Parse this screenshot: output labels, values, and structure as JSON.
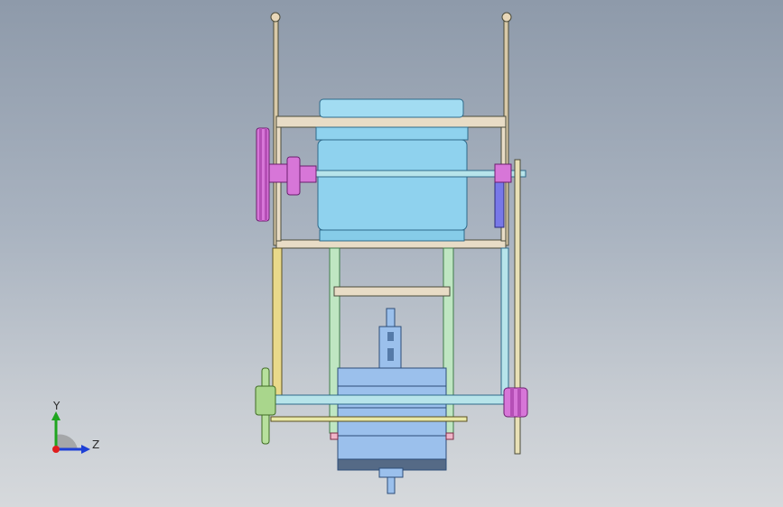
{
  "viewport": {
    "background_top": "#8e9aaa",
    "background_bottom": "#d6d9dc"
  },
  "triad": {
    "y_label": "Y",
    "z_label": "Z",
    "colors": {
      "y": "#1fa51f",
      "z": "#1d3fd6",
      "x": "#e01d1d"
    }
  },
  "model": {
    "colors": {
      "frame": "#e8dcc6",
      "frame_edge": "#4b4b3a",
      "motor": "#8fd2ee",
      "motor_edge": "#2f6a8a",
      "pulley": "#d776d8",
      "pulley_edge": "#6b1f6e",
      "link": "#bfe6c2",
      "link_edge": "#3f7a49",
      "drum": "#9bc0ec",
      "drum_edge": "#2d4d78",
      "shaft": "#b7e4ea",
      "rod": "#e8e8a6",
      "sprocket": "#b7e09d",
      "bracket_yellow": "#e9d98a",
      "blue_plate": "#7878e8"
    }
  }
}
